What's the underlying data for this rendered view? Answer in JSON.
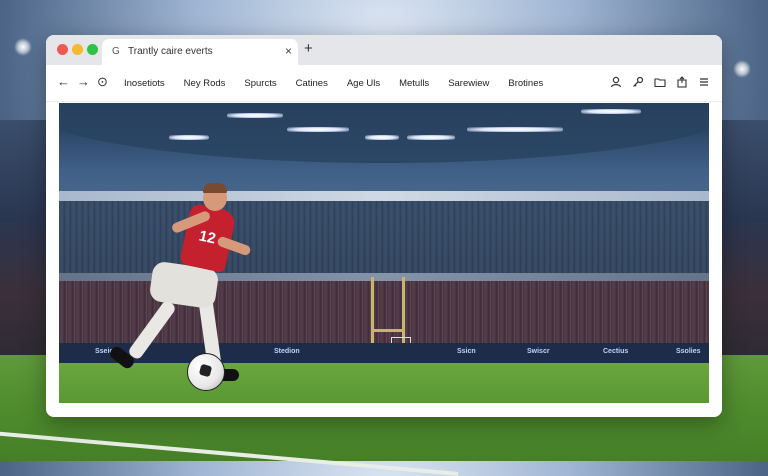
{
  "browser": {
    "tab_title": "Trantly caire everts",
    "tab_favicon": "G",
    "close_icon": "×",
    "new_tab_icon": "+"
  },
  "toolbar": {
    "back_icon": "←",
    "forward_icon": "→",
    "history_icon": "⊙",
    "menu": [
      "Inosetiots",
      "Ney Rods",
      "Spurcts",
      "Catines",
      "Age Uls",
      "Metulls",
      "Sarewiew",
      "Brotines"
    ],
    "right_icons": [
      "account-icon",
      "key-icon",
      "folder-icon",
      "share-icon",
      "menu-icon"
    ]
  },
  "hero": {
    "board_texts": [
      "Sseicn",
      "Stedion",
      "Ssicn",
      "Swiscr",
      "Cectius",
      "Ssolies"
    ],
    "jersey_number": "12"
  },
  "colors": {
    "traffic_red": "#ee5a52",
    "traffic_yellow": "#f5b82e",
    "traffic_green": "#2fc244",
    "jersey": "#c4202e"
  }
}
